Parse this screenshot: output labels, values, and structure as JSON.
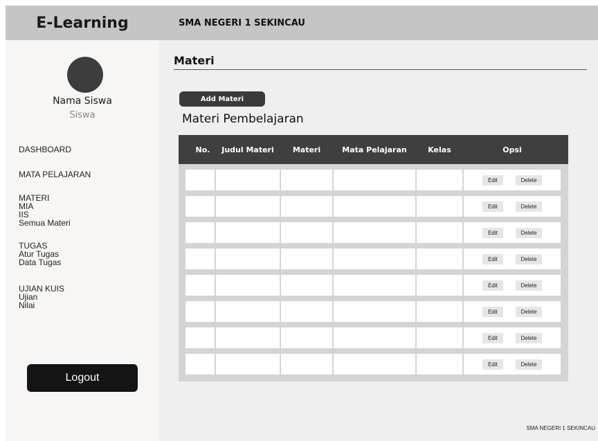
{
  "header": {
    "brand": "E-Learning",
    "school": "SMA NEGERI 1 SEKINCAU"
  },
  "sidebar": {
    "user_name": "Nama Siswa",
    "user_role": "Siswa",
    "menu": {
      "dashboard": "DASHBOARD",
      "mata_pelajaran": "MATA PELAJARAN",
      "materi": "MATERI",
      "materi_items": [
        "MIA",
        "IIS",
        "Semua Materi"
      ],
      "tugas": "TUGAS",
      "tugas_items": [
        "Atur Tugas",
        "Data Tugas"
      ],
      "ujian_kuis": "UJIAN KUIS",
      "ujian_items": [
        "Ujian",
        "Nilai"
      ]
    },
    "logout": "Logout"
  },
  "main": {
    "page_title": "Materi",
    "add_button": "Add Materi",
    "section_title": "Materi Pembelajaran",
    "table": {
      "columns": [
        "No.",
        "Judul Materi",
        "Materi",
        "Mata Pelajaran",
        "Kelas",
        "Opsi"
      ],
      "row_count": 8,
      "edit_label": "Edit",
      "delete_label": "Delete"
    }
  },
  "footer": {
    "text": "SMA NEGERI 1 SEKINCAU"
  }
}
